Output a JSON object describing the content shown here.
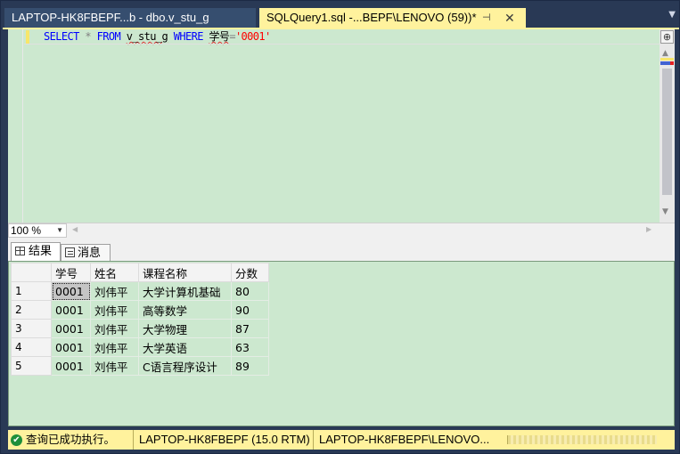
{
  "tabs": [
    {
      "label": "LAPTOP-HK8FBEPF...b - dbo.v_stu_g"
    },
    {
      "label": "SQLQuery1.sql -...BEPF\\LENOVO (59))*",
      "pin": "⊣",
      "close": "✕"
    }
  ],
  "editor": {
    "keyword_select": "SELECT",
    "star": "*",
    "keyword_from": "FROM",
    "table": "v_stu_g",
    "keyword_where": "WHERE",
    "column": "学号",
    "equals": "=",
    "value": "'0001'",
    "split_button": "⊕"
  },
  "zoom": {
    "value": "100 %"
  },
  "result_tabs": [
    {
      "label": "结果",
      "icon": "grid-icon"
    },
    {
      "label": "消息",
      "icon": "message-icon"
    }
  ],
  "results": {
    "columns": [
      "学号",
      "姓名",
      "课程名称",
      "分数"
    ],
    "rows": [
      {
        "n": "1",
        "cells": [
          "0001",
          "刘伟平",
          "大学计算机基础",
          "80"
        ]
      },
      {
        "n": "2",
        "cells": [
          "0001",
          "刘伟平",
          "高等数学",
          "90"
        ]
      },
      {
        "n": "3",
        "cells": [
          "0001",
          "刘伟平",
          "大学物理",
          "87"
        ]
      },
      {
        "n": "4",
        "cells": [
          "0001",
          "刘伟平",
          "大学英语",
          "63"
        ]
      },
      {
        "n": "5",
        "cells": [
          "0001",
          "刘伟平",
          "C语言程序设计",
          "89"
        ]
      }
    ]
  },
  "status": {
    "message": "查询已成功执行。",
    "server": "LAPTOP-HK8FBEPF (15.0 RTM)",
    "connection": "LAPTOP-HK8FBEPF\\LENOVO...",
    "status_color": "#fff29d",
    "ok_icon": "check-circle-icon"
  }
}
